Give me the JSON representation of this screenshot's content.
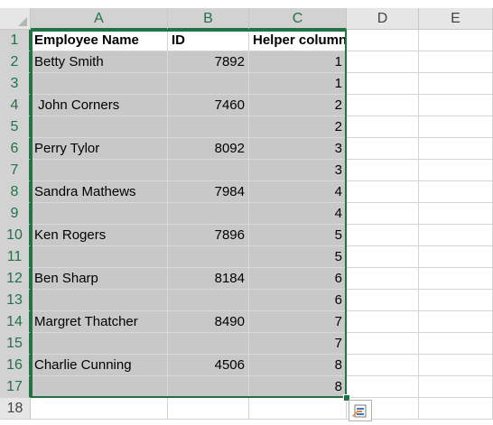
{
  "columns": [
    "A",
    "B",
    "C",
    "D",
    "E"
  ],
  "rows": [
    "1",
    "2",
    "3",
    "4",
    "5",
    "6",
    "7",
    "8",
    "9",
    "10",
    "11",
    "12",
    "13",
    "14",
    "15",
    "16",
    "17",
    "18"
  ],
  "header": {
    "name": "Employee Name",
    "id": "ID",
    "helper": "Helper column"
  },
  "data": [
    {
      "name": "Betty Smith",
      "id": "7892",
      "helper": "1"
    },
    {
      "name": "",
      "id": "",
      "helper": "1"
    },
    {
      "name": " John Corners",
      "id": "7460",
      "helper": "2"
    },
    {
      "name": "",
      "id": "",
      "helper": "2"
    },
    {
      "name": "Perry Tylor",
      "id": "8092",
      "helper": "3"
    },
    {
      "name": "",
      "id": "",
      "helper": "3"
    },
    {
      "name": "Sandra Mathews",
      "id": "7984",
      "helper": "4"
    },
    {
      "name": "",
      "id": "",
      "helper": "4"
    },
    {
      "name": "Ken Rogers",
      "id": "7896",
      "helper": "5"
    },
    {
      "name": "",
      "id": "",
      "helper": "5"
    },
    {
      "name": "Ben Sharp",
      "id": "8184",
      "helper": "6"
    },
    {
      "name": "",
      "id": "",
      "helper": "6"
    },
    {
      "name": "Margret Thatcher",
      "id": "8490",
      "helper": "7"
    },
    {
      "name": "",
      "id": "",
      "helper": "7"
    },
    {
      "name": "Charlie Cunning",
      "id": "4506",
      "helper": "8"
    },
    {
      "name": "",
      "id": "",
      "helper": "8"
    }
  ],
  "colors": {
    "selection_border": "#217346",
    "selected_fill": "#c8c8c8",
    "header_bg": "#e6e6e6"
  },
  "icons": {
    "quick_analysis": "quick-analysis-icon"
  }
}
